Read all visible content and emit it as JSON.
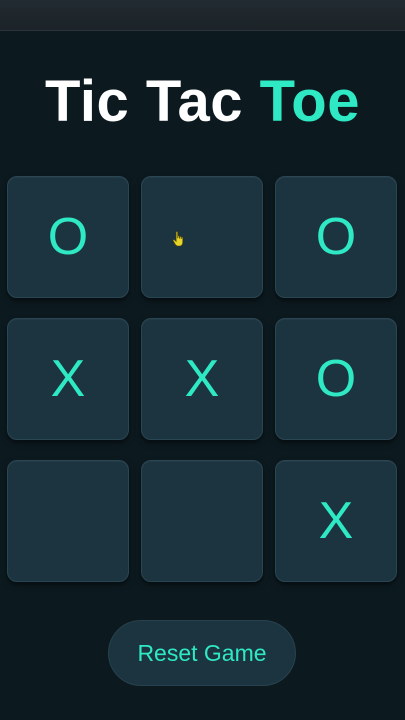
{
  "title": {
    "main": "Tic Tac ",
    "accent": "Toe"
  },
  "board": {
    "cells": [
      "O",
      "",
      "O",
      "X",
      "X",
      "O",
      "",
      "",
      "X"
    ]
  },
  "cursor_icon": "pointer-hand-icon",
  "reset_label": "Reset Game",
  "colors": {
    "background": "#0c1a20",
    "cell": "#1c3440",
    "accent": "#2ee9c4",
    "title": "#ffffff",
    "cursor": "#e6d62a"
  }
}
